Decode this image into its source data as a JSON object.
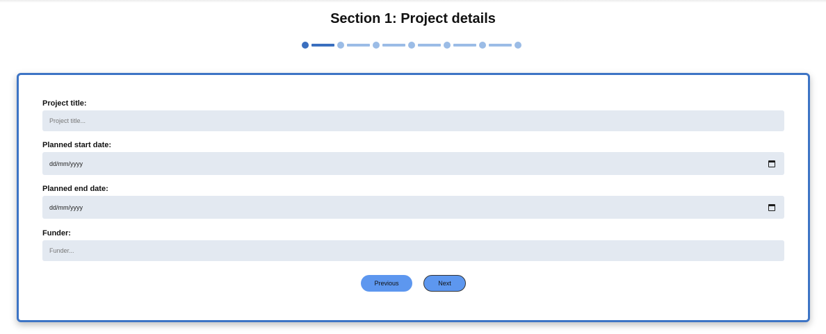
{
  "header": {
    "title": "Section 1: Project details"
  },
  "stepper": {
    "total_steps": 7,
    "current_step": 1
  },
  "form": {
    "project_title": {
      "label": "Project title:",
      "placeholder": "Project title...",
      "value": ""
    },
    "start_date": {
      "label": "Planned start date:",
      "display": "dd/mm/yyyy"
    },
    "end_date": {
      "label": "Planned end date:",
      "display": "dd/mm/yyyy"
    },
    "funder": {
      "label": "Funder:",
      "placeholder": "Funder...",
      "value": ""
    }
  },
  "buttons": {
    "previous_label": "Previous",
    "next_label": "Next"
  },
  "colors": {
    "accent": "#3d74c5",
    "step_active": "#3a6fbf",
    "step_inactive": "#9bbce6",
    "input_background": "#e3e9f1",
    "button": "#5d97ef"
  }
}
